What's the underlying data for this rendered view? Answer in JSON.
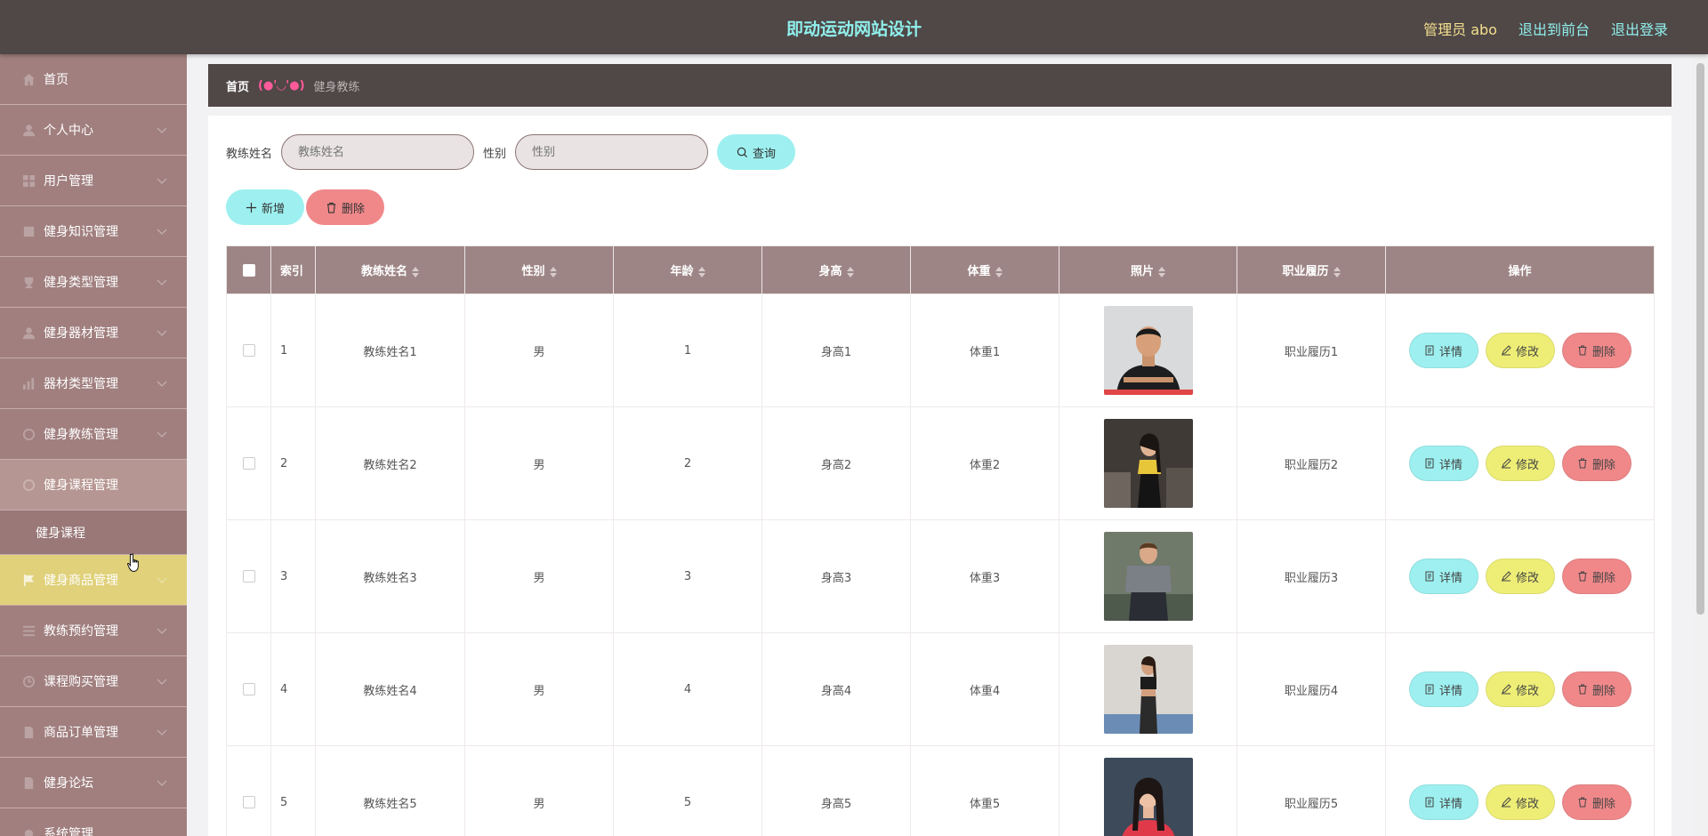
{
  "header": {
    "title": "即动运动网站设计",
    "user": "管理员 abo",
    "to_front": "退出到前台",
    "logout": "退出登录"
  },
  "sidebar": {
    "items": [
      {
        "label": "首页",
        "icon": "home-icon"
      },
      {
        "label": "个人中心",
        "icon": "user-icon"
      },
      {
        "label": "用户管理",
        "icon": "grid-icon"
      },
      {
        "label": "健身知识管理",
        "icon": "book-icon"
      },
      {
        "label": "健身类型管理",
        "icon": "trophy-icon"
      },
      {
        "label": "健身器材管理",
        "icon": "user-icon"
      },
      {
        "label": "器材类型管理",
        "icon": "bar-chart-icon"
      },
      {
        "label": "健身教练管理",
        "icon": "circle-icon"
      },
      {
        "label": "健身课程管理",
        "icon": "circle-icon"
      },
      {
        "label": "健身商品管理",
        "icon": "flag-icon"
      },
      {
        "label": "教练预约管理",
        "icon": "list-icon"
      },
      {
        "label": "课程购买管理",
        "icon": "clock-icon"
      },
      {
        "label": "商品订单管理",
        "icon": "doc-icon"
      },
      {
        "label": "健身论坛",
        "icon": "doc-icon"
      },
      {
        "label": "系统管理",
        "icon": "gear-icon"
      }
    ],
    "submenu": "健身课程"
  },
  "breadcrumb": {
    "home": "首页",
    "face": "(●'◡'●)",
    "current": "健身教练"
  },
  "search": {
    "name_label": "教练姓名",
    "name_placeholder": "教练姓名",
    "gender_label": "性别",
    "gender_placeholder": "性别",
    "query": "查询"
  },
  "toolbar": {
    "add": "新增",
    "delete": "删除"
  },
  "table": {
    "columns": [
      "索引",
      "教练姓名",
      "性别",
      "年龄",
      "身高",
      "体重",
      "照片",
      "职业履历",
      "操作"
    ],
    "rows": [
      {
        "index": "1",
        "name": "教练姓名1",
        "gender": "男",
        "age": "1",
        "height": "身高1",
        "weight": "体重1",
        "resume": "职业履历1"
      },
      {
        "index": "2",
        "name": "教练姓名2",
        "gender": "男",
        "age": "2",
        "height": "身高2",
        "weight": "体重2",
        "resume": "职业履历2"
      },
      {
        "index": "3",
        "name": "教练姓名3",
        "gender": "男",
        "age": "3",
        "height": "身高3",
        "weight": "体重3",
        "resume": "职业履历3"
      },
      {
        "index": "4",
        "name": "教练姓名4",
        "gender": "男",
        "age": "4",
        "height": "身高4",
        "weight": "体重4",
        "resume": "职业履历4"
      },
      {
        "index": "5",
        "name": "教练姓名5",
        "gender": "男",
        "age": "5",
        "height": "身高5",
        "weight": "体重5",
        "resume": "职业履历5"
      }
    ],
    "ops": {
      "detail": "详情",
      "edit": "修改",
      "delete": "删除"
    }
  },
  "colors": {
    "header_bg": "#504747",
    "title": "#8ff0ec",
    "sidebar_bg": "#a17f7f",
    "th_bg": "#9e8585",
    "accent_cyan": "#9ef0f0",
    "accent_yellow": "#eeee77",
    "accent_red": "#f0888a"
  }
}
